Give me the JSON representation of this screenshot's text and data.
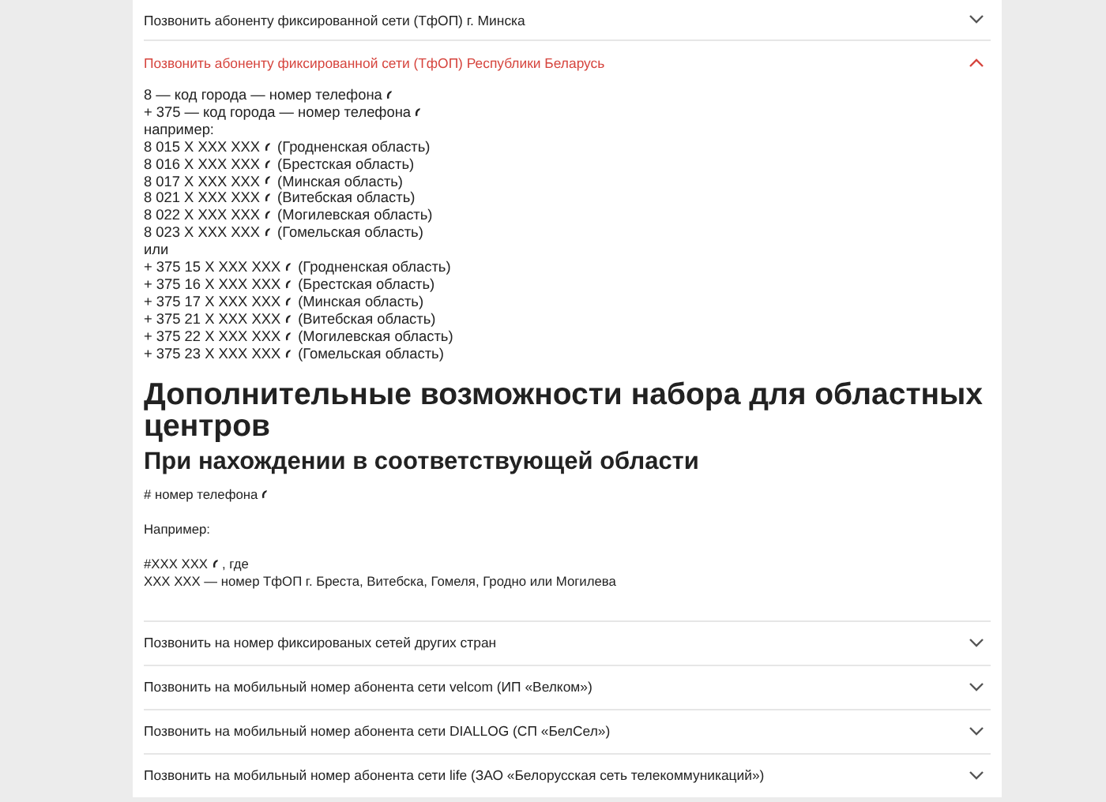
{
  "accordion": [
    {
      "title": "Позвонить абоненту фиксированной сети (ТфОП) г. Минска",
      "expanded": false
    },
    {
      "title": "Позвонить абоненту фиксированной сети (ТфОП) Республики Беларусь",
      "expanded": true,
      "content": {
        "lines": [
          {
            "kind": "phone",
            "number": "8 — код города — номер телефона"
          },
          {
            "kind": "phone",
            "number": "+ 375 — код города — номер телефона"
          },
          {
            "kind": "text",
            "number": "например:"
          },
          {
            "kind": "phone",
            "number": "8 015 X XXX XXX",
            "note": "(Гродненская область)"
          },
          {
            "kind": "phone",
            "number": "8 016 X XXX XXX",
            "note": "(Брестская область)"
          },
          {
            "kind": "phone",
            "number": "8 017 X XXX XXX",
            "note": "(Минская область)"
          },
          {
            "kind": "phone",
            "number": "8 021 X XXX XXX",
            "note": "(Витебская область)"
          },
          {
            "kind": "phone",
            "number": "8 022 X XXX XXX",
            "note": "(Могилевская область)"
          },
          {
            "kind": "phone",
            "number": "8 023 X XXX XXX",
            "note": "(Гомельская область)"
          },
          {
            "kind": "text",
            "number": "или"
          },
          {
            "kind": "phone",
            "number": "+ 375 15 X XXX XXX",
            "note": "(Гродненская область)"
          },
          {
            "kind": "phone",
            "number": "+ 375 16 X XXX XXX",
            "note": "(Брестская область)"
          },
          {
            "kind": "phone",
            "number": "+ 375 17 X XXX XXX",
            "note": "(Минская область)"
          },
          {
            "kind": "phone",
            "number": "+ 375 21 X XXX XXX",
            "note": "(Витебская область)"
          },
          {
            "kind": "phone",
            "number": "+ 375 22 X XXX XXX",
            "note": "(Могилевская область)"
          },
          {
            "kind": "phone",
            "number": "+ 375 23 X XXX XXX",
            "note": "(Гомельская область)"
          }
        ],
        "heading": "Дополнительные возможности набора для областных центров",
        "subheading": "При нахождении в соответствующей области",
        "paragraphs": [
          [
            {
              "kind": "phone",
              "number": "# номер телефона"
            }
          ],
          [
            {
              "kind": "text",
              "number": "Например:"
            }
          ],
          [
            {
              "kind": "phone",
              "number": "#XXX XXX",
              "note": ", где"
            },
            {
              "kind": "text",
              "number": "XXX XXX — номер ТфОП г. Бреста, Витебска, Гомеля, Гродно или Могилева"
            }
          ]
        ]
      }
    },
    {
      "title": "Позвонить на номер фиксированых сетей других стран",
      "expanded": false
    },
    {
      "title": "Позвонить на мобильный номер абонента сети velcom (ИП «Велком»)",
      "expanded": false
    },
    {
      "title": "Позвонить на мобильный номер абонента сети DIALLOG (СП «БелСел»)",
      "expanded": false
    },
    {
      "title": "Позвонить на мобильный номер абонента сети life (ЗАО «Белорусская сеть телекоммуникаций»)",
      "expanded": false
    }
  ]
}
